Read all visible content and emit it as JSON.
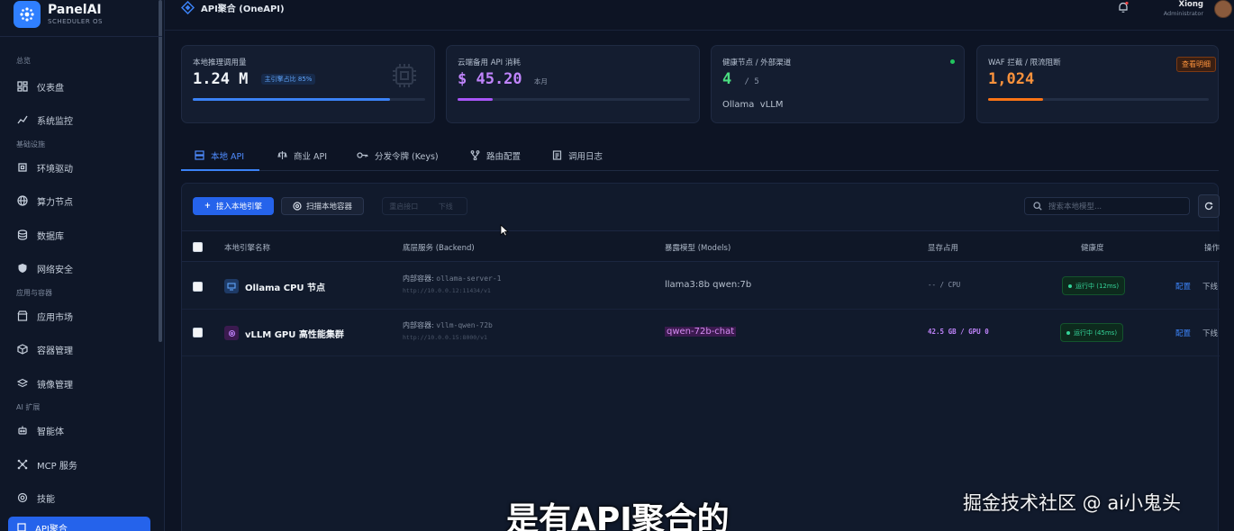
{
  "brand": {
    "name": "PanelAI",
    "subtitle": "SCHEDULER OS"
  },
  "sidebar": {
    "sections": [
      {
        "label": "总览"
      },
      {
        "label": "基础设施"
      },
      {
        "label": "应用与容器"
      },
      {
        "label": "AI 扩展"
      }
    ],
    "items": [
      {
        "label": "仪表盘",
        "icon": "dashboard-icon"
      },
      {
        "label": "系统监控",
        "icon": "chart-line-icon"
      },
      {
        "label": "环境驱动",
        "icon": "chip-icon"
      },
      {
        "label": "算力节点",
        "icon": "globe-icon"
      },
      {
        "label": "数据库",
        "icon": "database-icon"
      },
      {
        "label": "网络安全",
        "icon": "shield-icon"
      },
      {
        "label": "应用市场",
        "icon": "store-icon"
      },
      {
        "label": "容器管理",
        "icon": "box-icon"
      },
      {
        "label": "镜像管理",
        "icon": "layers-icon"
      },
      {
        "label": "智能体",
        "icon": "robot-icon"
      },
      {
        "label": "MCP 服务",
        "icon": "network-icon"
      },
      {
        "label": "技能",
        "icon": "target-icon"
      },
      {
        "label": "API聚合",
        "icon": "api-icon"
      }
    ]
  },
  "topbar": {
    "breadcrumb": "API聚合 (OneAPI)",
    "user_name": "Xiong",
    "user_role": "Administrator"
  },
  "cards": {
    "local": {
      "title": "本地推理调用量",
      "value": "1.24 M",
      "badge": "主引擎占比 85%",
      "progress": 0.85,
      "color": "#3b82f6"
    },
    "cloud": {
      "title": "云端备用 API 消耗",
      "value": "$ 45.20",
      "suffix": "本月",
      "progress": 0.15,
      "color": "#a855f7"
    },
    "health": {
      "title": "健康节点 / 外部渠道",
      "value": "4",
      "total": "/ 5",
      "tags": "Ollama  vLLM",
      "color": "#4ade80"
    },
    "waf": {
      "title": "WAF 拦截 / 限流阻断",
      "value": "1,024",
      "button": "查看明细",
      "progress": 0.25,
      "color": "#f97316"
    }
  },
  "tabs": [
    {
      "label": "本地 API"
    },
    {
      "label": "商业 API"
    },
    {
      "label": "分发令牌 (Keys)"
    },
    {
      "label": "路由配置"
    },
    {
      "label": "调用日志"
    }
  ],
  "toolbar": {
    "add_label": "接入本地引擎",
    "scan_label": "扫描本地容器",
    "restart_label": "重启接口",
    "offline_label": "下线",
    "search_placeholder": "搜索本地模型..."
  },
  "table": {
    "headers": [
      "本地引擎名称",
      "底层服务 (Backend)",
      "暴露模型 (Models)",
      "显存占用",
      "健康度",
      "操作"
    ],
    "rows": [
      {
        "name": "Ollama CPU 节点",
        "backend_label": "内部容器: ",
        "backend_container": "ollama-server-1",
        "backend_url": "http://10.0.0.12:11434/v1",
        "models": "llama3:8b qwen:7b",
        "memory": "-- / CPU",
        "health": "运行中 (12ms)",
        "config": "配置",
        "offline": "下线"
      },
      {
        "name": "vLLM GPU 高性能集群",
        "backend_label": "内部容器: ",
        "backend_container": "vllm-qwen-72b",
        "backend_url": "http://10.0.0.15:8000/v1",
        "models": "qwen-72b-chat",
        "memory": "42.5 GB / GPU 0",
        "health": "运行中 (45ms)",
        "config": "配置",
        "offline": "下线"
      }
    ]
  },
  "overlay": {
    "subtitle": "是有API聚合的",
    "watermark": "掘金技术社区 @ ai小鬼头"
  }
}
